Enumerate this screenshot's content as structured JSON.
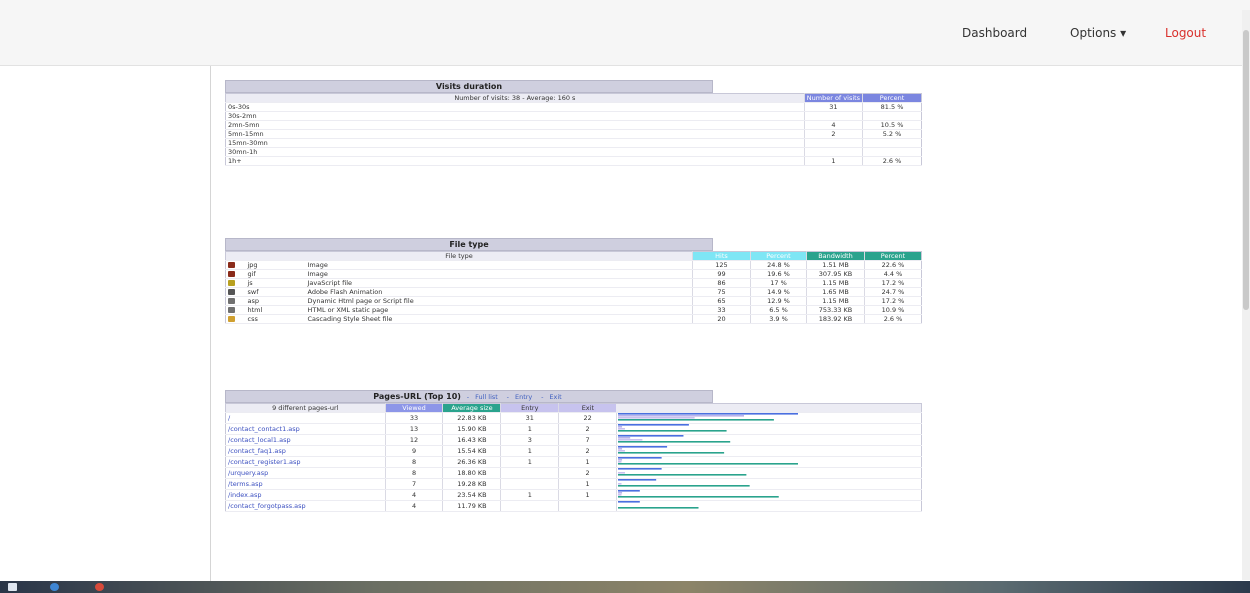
{
  "nav": {
    "dashboard": "Dashboard",
    "options": "Options ▾",
    "logout": "Logout"
  },
  "visits_duration": {
    "title": "Visits duration",
    "summary": "Number of visits: 38 - Average: 160 s",
    "col_visits": "Number of visits",
    "col_percent": "Percent",
    "rows": [
      {
        "label": "0s-30s",
        "visits": "31",
        "percent": "81.5 %"
      },
      {
        "label": "30s-2mn",
        "visits": "",
        "percent": ""
      },
      {
        "label": "2mn-5mn",
        "visits": "4",
        "percent": "10.5 %"
      },
      {
        "label": "5mn-15mn",
        "visits": "2",
        "percent": "5.2 %"
      },
      {
        "label": "15mn-30mn",
        "visits": "",
        "percent": ""
      },
      {
        "label": "30mn-1h",
        "visits": "",
        "percent": ""
      },
      {
        "label": "1h+",
        "visits": "1",
        "percent": "2.6 %"
      }
    ]
  },
  "file_type": {
    "title": "File type",
    "col_type": "File type",
    "col_hits": "Hits",
    "col_percent": "Percent",
    "col_bandwidth": "Bandwidth",
    "col_bw_percent": "Percent",
    "rows": [
      {
        "icon": "image-icon",
        "icon_color": "#8a2b1a",
        "ext": "jpg",
        "desc": "Image",
        "hits": "125",
        "hits_pct": "24.8 %",
        "bandwidth": "1.51 MB",
        "bw_pct": "22.6 %"
      },
      {
        "icon": "image-icon",
        "icon_color": "#8a2b1a",
        "ext": "gif",
        "desc": "Image",
        "hits": "99",
        "hits_pct": "19.6 %",
        "bandwidth": "307.95 KB",
        "bw_pct": "4.4 %"
      },
      {
        "icon": "script-icon",
        "icon_color": "#b8a020",
        "ext": "js",
        "desc": "JavaScript file",
        "hits": "86",
        "hits_pct": "17 %",
        "bandwidth": "1.15 MB",
        "bw_pct": "17.2 %"
      },
      {
        "icon": "flash-icon",
        "icon_color": "#555555",
        "ext": "swf",
        "desc": "Adobe Flash Animation",
        "hits": "75",
        "hits_pct": "14.9 %",
        "bandwidth": "1.65 MB",
        "bw_pct": "24.7 %"
      },
      {
        "icon": "page-icon",
        "icon_color": "#707070",
        "ext": "asp",
        "desc": "Dynamic Html page or Script file",
        "hits": "65",
        "hits_pct": "12.9 %",
        "bandwidth": "1.15 MB",
        "bw_pct": "17.2 %"
      },
      {
        "icon": "page-icon",
        "icon_color": "#707070",
        "ext": "html",
        "desc": "HTML or XML static page",
        "hits": "33",
        "hits_pct": "6.5 %",
        "bandwidth": "753.33 KB",
        "bw_pct": "10.9 %"
      },
      {
        "icon": "style-icon",
        "icon_color": "#d0a030",
        "ext": "css",
        "desc": "Cascading Style Sheet file",
        "hits": "20",
        "hits_pct": "3.9 %",
        "bandwidth": "183.92 KB",
        "bw_pct": "2.6 %"
      }
    ]
  },
  "pages_url": {
    "title": "Pages-URL (Top 10)",
    "links": [
      "Full list",
      "Entry",
      "Exit"
    ],
    "summary": "9 different pages-url",
    "col_viewed": "Viewed",
    "col_avg": "Average size",
    "col_entry": "Entry",
    "col_exit": "Exit",
    "rows": [
      {
        "url": "/",
        "viewed": "33",
        "avg": "22.83 KB",
        "entry": "31",
        "exit": "22",
        "viewed_n": 33,
        "avg_kb": 22.83,
        "entry_n": 31,
        "exit_n": 22
      },
      {
        "url": "/contact_contact1.asp",
        "viewed": "13",
        "avg": "15.90 KB",
        "entry": "1",
        "exit": "2",
        "viewed_n": 13,
        "avg_kb": 15.9,
        "entry_n": 1,
        "exit_n": 2
      },
      {
        "url": "/contact_local1.asp",
        "viewed": "12",
        "avg": "16.43 KB",
        "entry": "3",
        "exit": "7",
        "viewed_n": 12,
        "avg_kb": 16.43,
        "entry_n": 3,
        "exit_n": 7
      },
      {
        "url": "/contact_faq1.asp",
        "viewed": "9",
        "avg": "15.54 KB",
        "entry": "1",
        "exit": "2",
        "viewed_n": 9,
        "avg_kb": 15.54,
        "entry_n": 1,
        "exit_n": 2
      },
      {
        "url": "/contact_register1.asp",
        "viewed": "8",
        "avg": "26.36 KB",
        "entry": "1",
        "exit": "1",
        "viewed_n": 8,
        "avg_kb": 26.36,
        "entry_n": 1,
        "exit_n": 1
      },
      {
        "url": "/urquery.asp",
        "viewed": "8",
        "avg": "18.80 KB",
        "entry": "",
        "exit": "2",
        "viewed_n": 8,
        "avg_kb": 18.8,
        "entry_n": 0,
        "exit_n": 2
      },
      {
        "url": "/terms.asp",
        "viewed": "7",
        "avg": "19.28 KB",
        "entry": "",
        "exit": "1",
        "viewed_n": 7,
        "avg_kb": 19.28,
        "entry_n": 0,
        "exit_n": 1
      },
      {
        "url": "/index.asp",
        "viewed": "4",
        "avg": "23.54 KB",
        "entry": "1",
        "exit": "1",
        "viewed_n": 4,
        "avg_kb": 23.54,
        "entry_n": 1,
        "exit_n": 1
      },
      {
        "url": "/contact_forgotpass.asp",
        "viewed": "4",
        "avg": "11.79 KB",
        "entry": "",
        "exit": "",
        "viewed_n": 4,
        "avg_kb": 11.79,
        "entry_n": 0,
        "exit_n": 0
      }
    ]
  },
  "colors": {
    "viewed": "#4a6fe0",
    "avg": "#2aa38d",
    "entry": "#b9b2ea",
    "exit": "#c9c0f0"
  }
}
